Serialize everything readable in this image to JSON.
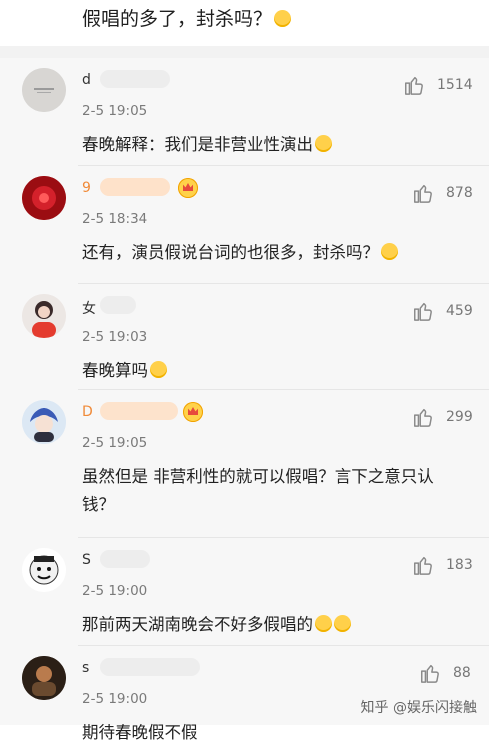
{
  "top": {
    "comment_text": "假唱的多了，封杀吗？"
  },
  "comments": [
    {
      "username": "d",
      "time": "2-5 19:05",
      "text": "春晚解释：我们是非营业性演出",
      "likes": "1514",
      "emoji": "yes"
    },
    {
      "username": "9",
      "time": "2-5 18:34",
      "text": "还有，演员假说台词的也很多，封杀吗？",
      "likes": "878",
      "emoji": "yes",
      "badge": "crown"
    },
    {
      "username": "女",
      "time": "2-5 19:03",
      "text": "春晚算吗",
      "likes": "459",
      "emoji": "yes"
    },
    {
      "username": "D",
      "time": "2-5 19:05",
      "text": "虽然但是 非营利性的就可以假唱？言下之意只认钱？",
      "likes": "299",
      "badge": "crown"
    },
    {
      "username": "S",
      "time": "2-5 19:00",
      "text": "那前两天湖南晚会不好多假唱的",
      "likes": "183",
      "emoji": "yes"
    },
    {
      "username": "s",
      "time": "2-5 19:00",
      "text": "期待春晚假不假",
      "likes": "88"
    }
  ],
  "watermark": "知乎 @娱乐闪接触",
  "colors": {
    "orange": "#f08a38",
    "like_icon": "#8a8a8a"
  }
}
